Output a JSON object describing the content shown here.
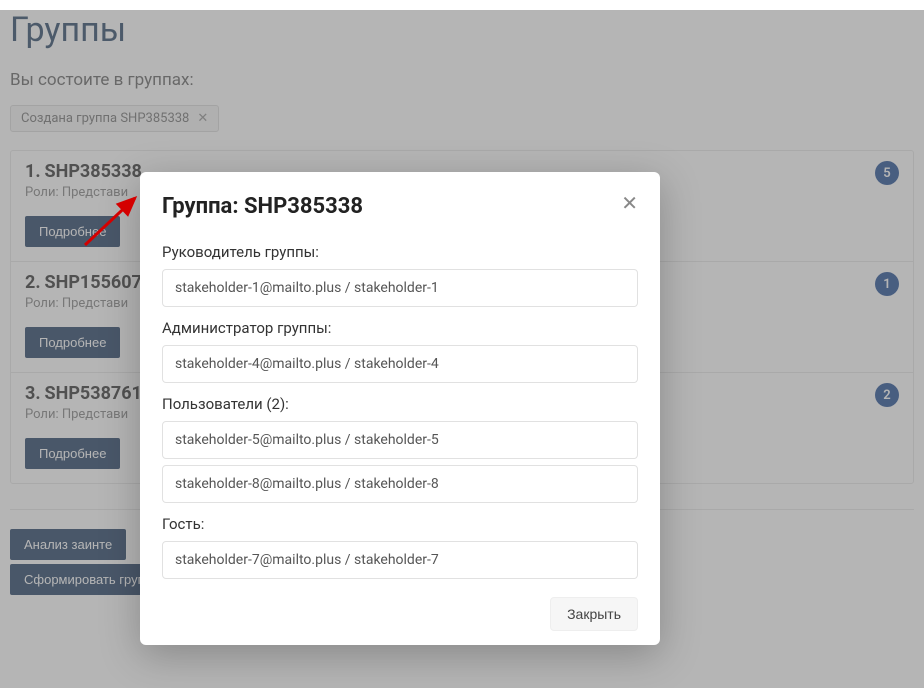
{
  "page": {
    "title": "Группы",
    "subheading": "Вы состоите в группах:"
  },
  "chip": {
    "text": "Создана группа SHP385338"
  },
  "groups": [
    {
      "idx": "1.",
      "name": "SHP385338",
      "roles": "Роли: Представи",
      "badge": "5",
      "more": "Подробнее"
    },
    {
      "idx": "2.",
      "name": "SHP155607",
      "roles": "Роли: Представи",
      "badge": "1",
      "more": "Подробнее"
    },
    {
      "idx": "3.",
      "name": "SHP538761",
      "roles": "Роли: Представи",
      "badge": "2",
      "more": "Подробнее"
    }
  ],
  "actions": {
    "analyze": "Анализ заинте",
    "form": "Сформировать группу под задачу"
  },
  "modal": {
    "title": "Группа: SHP385338",
    "labels": {
      "leader": "Руководитель группы:",
      "admin": "Администратор группы:",
      "users": "Пользователи (2):",
      "guest": "Гость:"
    },
    "leader": "stakeholder-1@mailto.plus / stakeholder-1",
    "admin": "stakeholder-4@mailto.plus / stakeholder-4",
    "users": [
      "stakeholder-5@mailto.plus / stakeholder-5",
      "stakeholder-8@mailto.plus / stakeholder-8"
    ],
    "guest": "stakeholder-7@mailto.plus / stakeholder-7",
    "close_btn": "Закрыть"
  }
}
